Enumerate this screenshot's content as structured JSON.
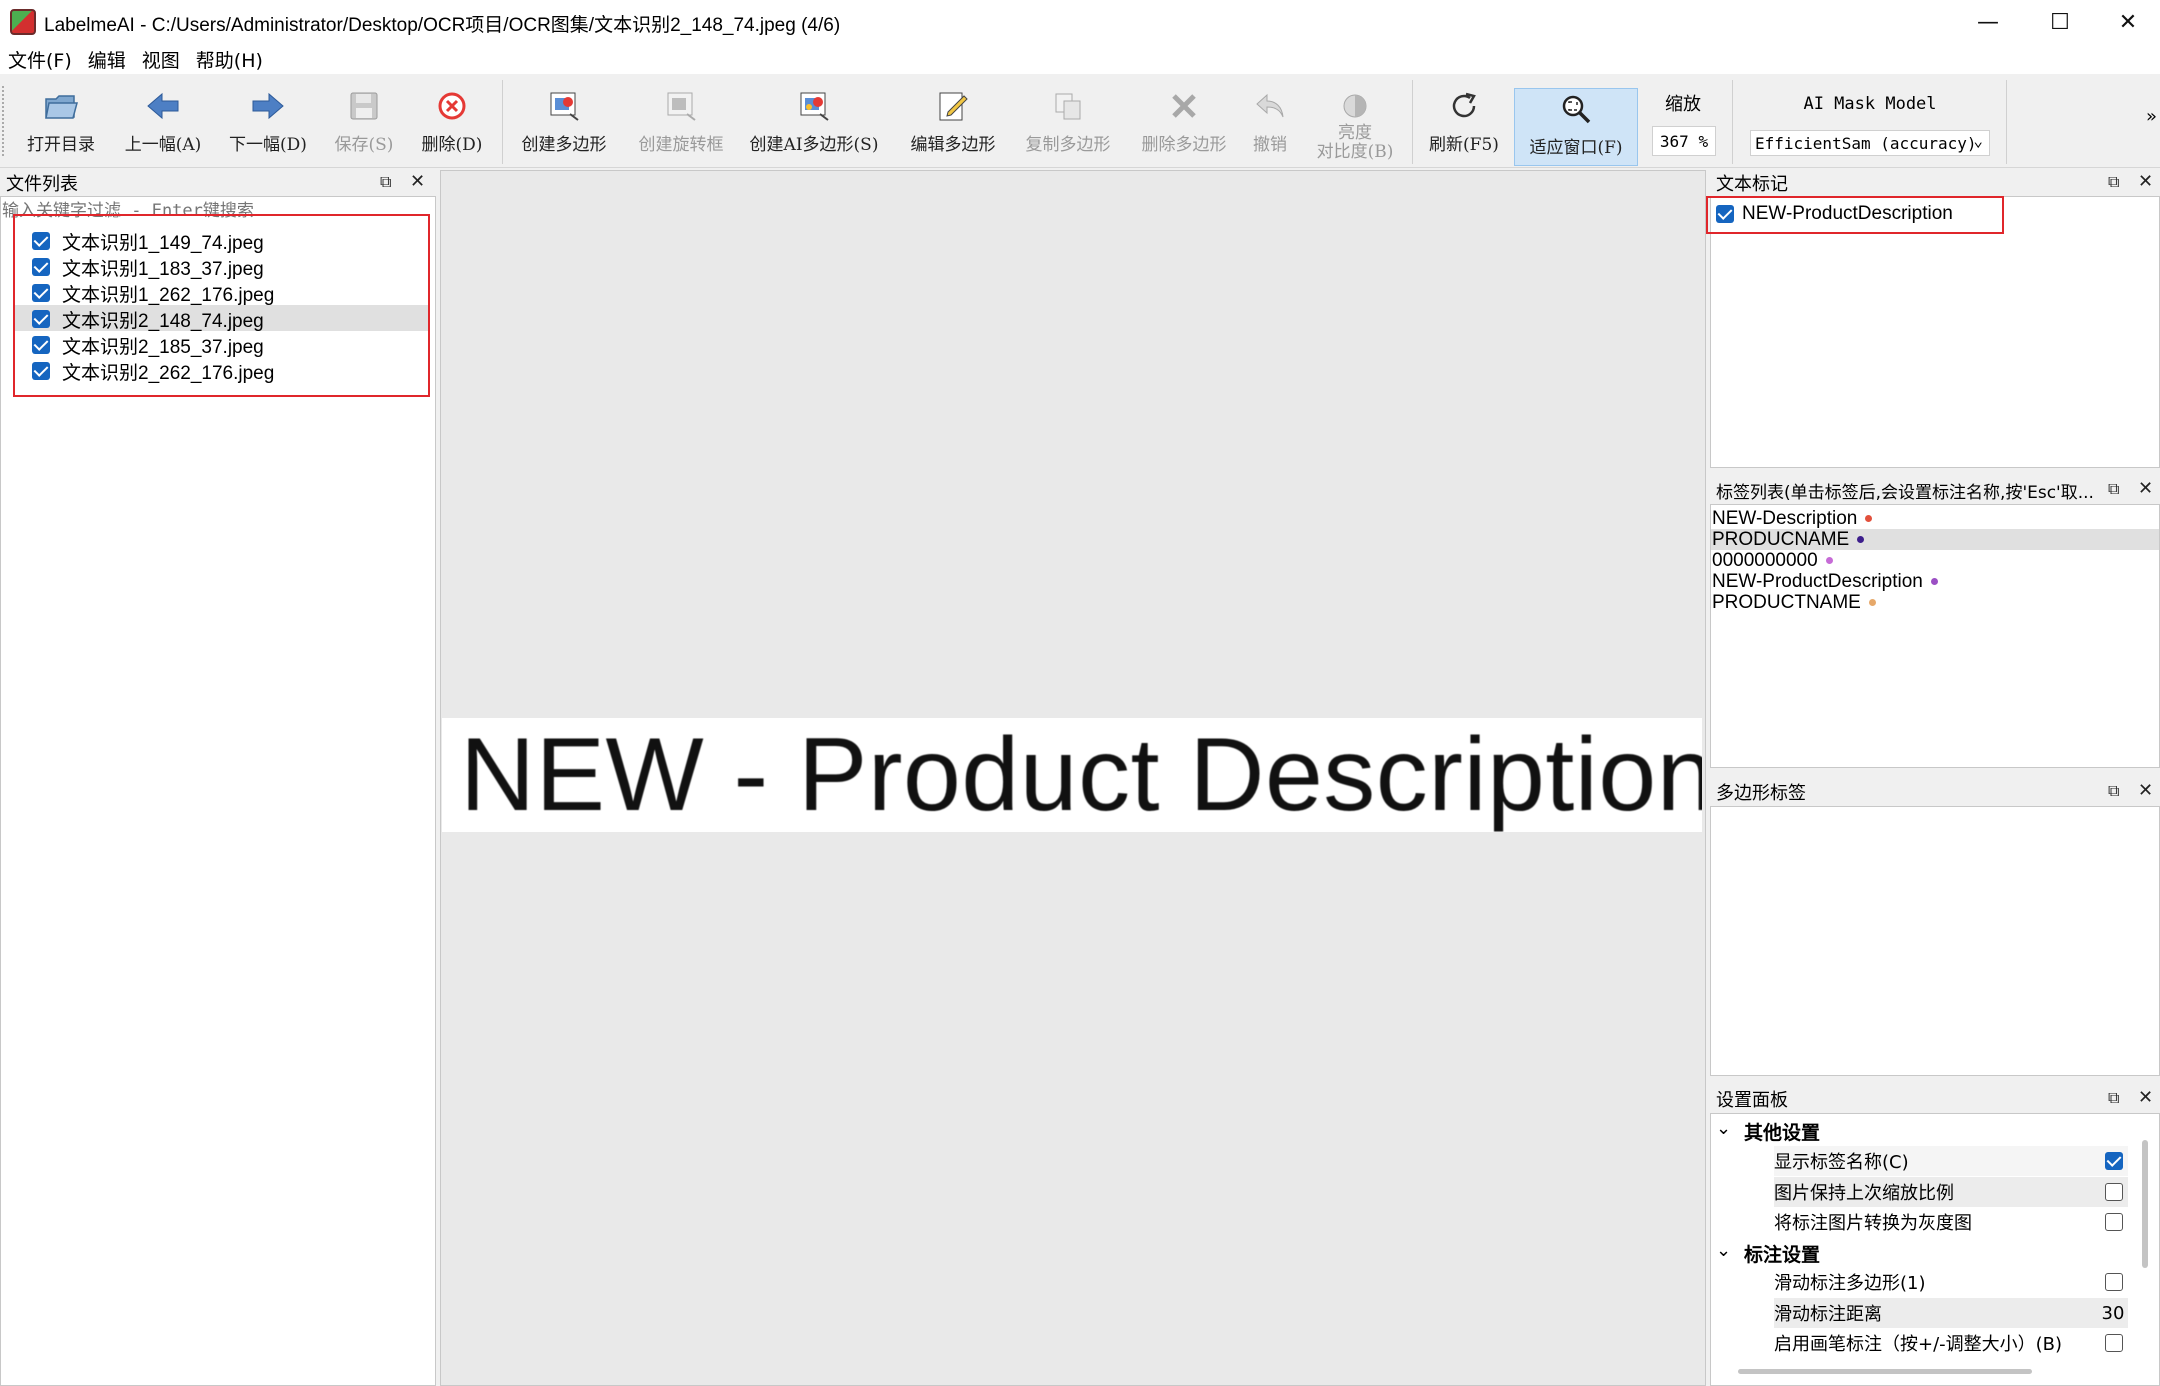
{
  "window": {
    "title": "LabelmeAI - C:/Users/Administrator/Desktop/OCR项目/OCR图集/文本识别2_148_74.jpeg (4/6)",
    "minimize": "—",
    "maximize": "☐",
    "close": "✕"
  },
  "menu": [
    "文件(F)",
    "编辑",
    "视图",
    "帮助(H)"
  ],
  "toolbar": {
    "open_dir": "打开目录",
    "prev": "上一幅(A)",
    "next": "下一幅(D)",
    "save": "保存(S)",
    "delete": "删除(D)",
    "create_polygon": "创建多边形",
    "create_rotated": "创建旋转框",
    "create_ai_polygon": "创建AI多边形(S)",
    "edit_polygon": "编辑多边形",
    "copy_polygon": "复制多边形",
    "delete_polygon": "删除多边形",
    "undo": "撤销",
    "brightness_1": "亮度",
    "brightness_2": "对比度(B)",
    "refresh": "刷新(F5)",
    "fit_window": "适应窗口(F)",
    "zoom_label": "缩放",
    "zoom_value": "367 %",
    "ai_model_label": "AI Mask Model",
    "ai_model_value": "EfficientSam (accuracy)",
    "overflow": "»"
  },
  "file_panel": {
    "title": "文件列表",
    "filter_placeholder": "输入关键字过滤 - Enter键搜索",
    "files": [
      {
        "name": "文本识别1_149_74.jpeg",
        "checked": true,
        "selected": false
      },
      {
        "name": "文本识别1_183_37.jpeg",
        "checked": true,
        "selected": false
      },
      {
        "name": "文本识别1_262_176.jpeg",
        "checked": true,
        "selected": false
      },
      {
        "name": "文本识别2_148_74.jpeg",
        "checked": true,
        "selected": true
      },
      {
        "name": "文本识别2_185_37.jpeg",
        "checked": true,
        "selected": false
      },
      {
        "name": "文本识别2_262_176.jpeg",
        "checked": true,
        "selected": false
      }
    ]
  },
  "canvas": {
    "image_text": "NEW - Product Description"
  },
  "text_mark_panel": {
    "title": "文本标记",
    "items": [
      {
        "label": "NEW-ProductDescription",
        "checked": true
      }
    ]
  },
  "label_list_panel": {
    "title": "标签列表(单击标签后,会设置标注名称,按'Esc'取...",
    "labels": [
      {
        "name": "NEW-Description",
        "color": "#e2503c",
        "selected": false
      },
      {
        "name": "PRODUCNAME",
        "color": "#3d1e8c",
        "selected": true
      },
      {
        "name": "0000000000",
        "color": "#c66bd6",
        "selected": false
      },
      {
        "name": "NEW-ProductDescription",
        "color": "#9b4fc4",
        "selected": false
      },
      {
        "name": "PRODUCTNAME",
        "color": "#e6a86a",
        "selected": false
      }
    ]
  },
  "polygon_label_panel": {
    "title": "多边形标签"
  },
  "settings_panel": {
    "title": "设置面板",
    "group_other": "其他设置",
    "show_label_name": "显示标签名称(C)",
    "keep_zoom": "图片保持上次缩放比例",
    "grayscale": "将标注图片转换为灰度图",
    "group_annot": "标注设置",
    "slide_polygon": "滑动标注多边形(1)",
    "slide_distance": "滑动标注距离",
    "slide_distance_value": "30",
    "brush_annot": "启用画笔标注（按+/-调整大小）(B)",
    "show_label_name_checked": true,
    "keep_zoom_checked": false,
    "grayscale_checked": false,
    "slide_polygon_checked": false,
    "brush_annot_checked": false
  },
  "colors": {
    "highlight_border": "#e0262b",
    "checkbox": "#1565c0",
    "active_tool": "#cfe4f7"
  }
}
